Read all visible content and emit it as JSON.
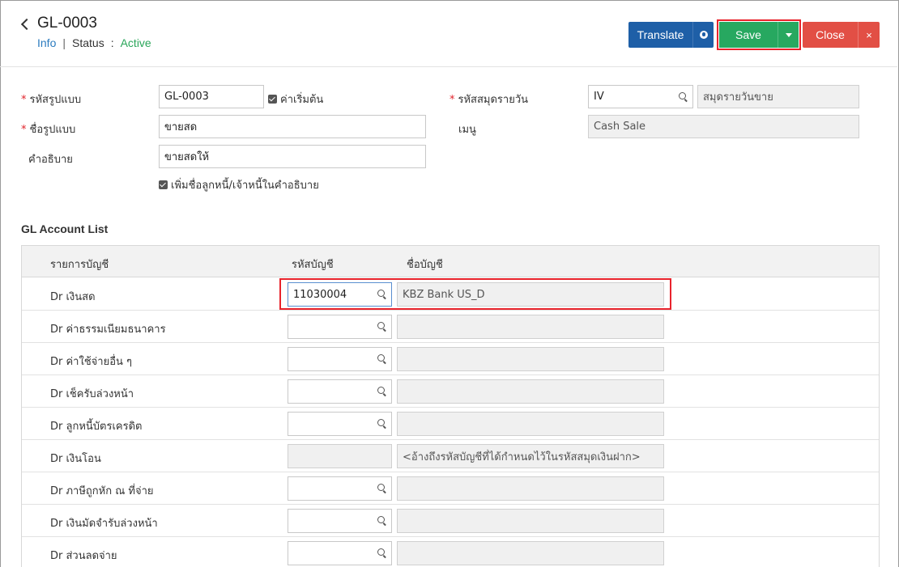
{
  "header": {
    "title": "GL-0003",
    "info_link": "Info",
    "separator": "|",
    "status_label": "Status",
    "colon": ":",
    "status_value": "Active",
    "translate_label": "Translate",
    "save_label": "Save",
    "close_label": "Close",
    "close_x": "×"
  },
  "form": {
    "template_code": {
      "label": "รหัสรูปแบบ",
      "value": "GL-0003",
      "default_checkbox": "ค่าเริ่มต้น"
    },
    "template_name": {
      "label": "ชื่อรูปแบบ",
      "value": "ขายสด"
    },
    "description": {
      "label": "คำอธิบาย",
      "value": "ขายสดให้"
    },
    "add_name_checkbox": "เพิ่มชื่อลูกหนี้/เจ้าหนี้ในคำอธิบาย",
    "journal_code": {
      "label": "รหัสสมุดรายวัน",
      "value": "IV",
      "name_value": "สมุดรายวันขาย"
    },
    "menu": {
      "label": "เมนู",
      "value": "Cash Sale"
    }
  },
  "gl_section": {
    "title": "GL Account List",
    "columns": [
      "รายการบัญชี",
      "รหัสบัญชี",
      "ชื่อบัญชี"
    ],
    "rows": [
      {
        "label": "Dr เงินสด",
        "code": "11030004",
        "name": "KBZ Bank US_D",
        "code_editable": true
      },
      {
        "label": "Dr ค่าธรรมเนียมธนาคาร",
        "code": "",
        "name": "",
        "code_editable": true
      },
      {
        "label": "Dr ค่าใช้จ่ายอื่น ๆ",
        "code": "",
        "name": "",
        "code_editable": true
      },
      {
        "label": "Dr เช็ครับล่วงหน้า",
        "code": "",
        "name": "",
        "code_editable": true
      },
      {
        "label": "Dr ลูกหนี้บัตรเครดิต",
        "code": "",
        "name": "",
        "code_editable": true
      },
      {
        "label": "Dr เงินโอน",
        "code": "",
        "name": "<อ้างถึงรหัสบัญชีที่ได้กำหนดไว้ในรหัสสมุดเงินฝาก>",
        "code_editable": false
      },
      {
        "label": "Dr ภาษีถูกหัก ณ ที่จ่าย",
        "code": "",
        "name": "",
        "code_editable": true
      },
      {
        "label": "Dr เงินมัดจำรับล่วงหน้า",
        "code": "",
        "name": "",
        "code_editable": true
      },
      {
        "label": "Dr ส่วนลดจ่าย",
        "code": "",
        "name": "",
        "code_editable": true
      }
    ]
  },
  "colors": {
    "translate": "#1e5fa7",
    "save": "#27a860",
    "close": "#e24f45",
    "highlight": "#e8232c",
    "status_active": "#2aa65a",
    "link": "#2b7bbf",
    "required": "#e0222a"
  },
  "icons": [
    "back-chevron-icon",
    "globe-icon",
    "caret-down-icon",
    "close-icon",
    "search-icon",
    "checkbox-checked-icon"
  ]
}
